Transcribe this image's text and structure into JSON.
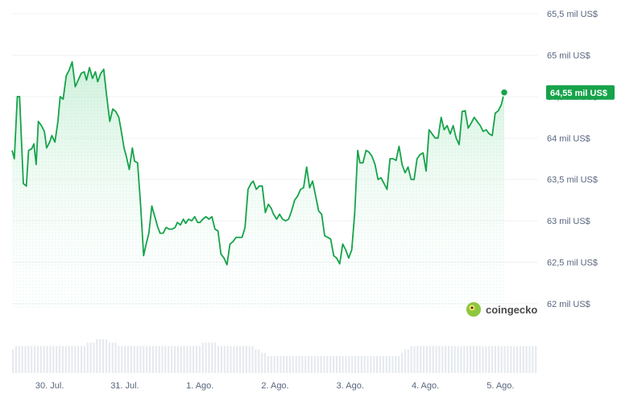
{
  "chart_data": {
    "type": "area",
    "currency_unit": "mil US$",
    "y_ticks": [
      62,
      62.5,
      63,
      63.5,
      64,
      64.5,
      65,
      65.5
    ],
    "y_tick_labels": [
      "62 mil US$",
      "62,5 mil US$",
      "63 mil US$",
      "63,5 mil US$",
      "64 mil US$",
      "64,5 mil US$",
      "65 mil US$",
      "65,5 mil US$"
    ],
    "ylim": [
      61.95,
      65.55
    ],
    "x_tick_labels": [
      "30. Jul.",
      "31. Jul.",
      "1. Ago.",
      "2. Ago.",
      "3. Ago.",
      "4. Ago.",
      "5. Ago."
    ],
    "x_tick_positions": [
      0.5,
      1.5,
      2.5,
      3.5,
      4.5,
      5.5,
      6.5
    ],
    "xlim": [
      0,
      7.0
    ],
    "series": [
      {
        "values": [
          [
            0.0,
            63.85
          ],
          [
            0.03,
            63.75
          ],
          [
            0.07,
            64.5
          ],
          [
            0.1,
            64.5
          ],
          [
            0.15,
            63.45
          ],
          [
            0.19,
            63.42
          ],
          [
            0.22,
            63.85
          ],
          [
            0.26,
            63.87
          ],
          [
            0.29,
            63.93
          ],
          [
            0.32,
            63.68
          ],
          [
            0.35,
            64.2
          ],
          [
            0.39,
            64.15
          ],
          [
            0.43,
            64.08
          ],
          [
            0.46,
            63.88
          ],
          [
            0.5,
            63.95
          ],
          [
            0.53,
            64.03
          ],
          [
            0.57,
            63.95
          ],
          [
            0.61,
            64.2
          ],
          [
            0.64,
            64.5
          ],
          [
            0.68,
            64.47
          ],
          [
            0.72,
            64.75
          ],
          [
            0.76,
            64.82
          ],
          [
            0.8,
            64.92
          ],
          [
            0.84,
            64.62
          ],
          [
            0.88,
            64.7
          ],
          [
            0.92,
            64.78
          ],
          [
            0.96,
            64.8
          ],
          [
            0.99,
            64.7
          ],
          [
            1.03,
            64.85
          ],
          [
            1.07,
            64.72
          ],
          [
            1.11,
            64.8
          ],
          [
            1.14,
            64.68
          ],
          [
            1.18,
            64.78
          ],
          [
            1.22,
            64.83
          ],
          [
            1.26,
            64.5
          ],
          [
            1.3,
            64.2
          ],
          [
            1.34,
            64.35
          ],
          [
            1.38,
            64.32
          ],
          [
            1.42,
            64.25
          ],
          [
            1.45,
            64.1
          ],
          [
            1.49,
            63.88
          ],
          [
            1.52,
            63.78
          ],
          [
            1.56,
            63.62
          ],
          [
            1.6,
            63.88
          ],
          [
            1.63,
            63.72
          ],
          [
            1.67,
            63.7
          ],
          [
            1.71,
            63.2
          ],
          [
            1.75,
            62.58
          ],
          [
            1.78,
            62.7
          ],
          [
            1.82,
            62.85
          ],
          [
            1.86,
            63.18
          ],
          [
            1.9,
            63.05
          ],
          [
            1.94,
            62.92
          ],
          [
            1.97,
            62.85
          ],
          [
            2.01,
            62.85
          ],
          [
            2.05,
            62.92
          ],
          [
            2.09,
            62.9
          ],
          [
            2.13,
            62.9
          ],
          [
            2.17,
            62.92
          ],
          [
            2.2,
            62.98
          ],
          [
            2.24,
            62.95
          ],
          [
            2.28,
            63.02
          ],
          [
            2.31,
            62.97
          ],
          [
            2.35,
            63.02
          ],
          [
            2.39,
            63.0
          ],
          [
            2.43,
            63.05
          ],
          [
            2.47,
            62.98
          ],
          [
            2.5,
            62.98
          ],
          [
            2.54,
            63.02
          ],
          [
            2.58,
            63.05
          ],
          [
            2.62,
            63.02
          ],
          [
            2.66,
            63.05
          ],
          [
            2.7,
            62.9
          ],
          [
            2.74,
            62.88
          ],
          [
            2.78,
            62.6
          ],
          [
            2.82,
            62.55
          ],
          [
            2.86,
            62.47
          ],
          [
            2.9,
            62.72
          ],
          [
            2.94,
            62.75
          ],
          [
            2.98,
            62.8
          ],
          [
            3.02,
            62.8
          ],
          [
            3.06,
            62.8
          ],
          [
            3.1,
            62.92
          ],
          [
            3.14,
            63.38
          ],
          [
            3.18,
            63.45
          ],
          [
            3.21,
            63.48
          ],
          [
            3.25,
            63.38
          ],
          [
            3.29,
            63.42
          ],
          [
            3.33,
            63.42
          ],
          [
            3.37,
            63.1
          ],
          [
            3.41,
            63.2
          ],
          [
            3.45,
            63.15
          ],
          [
            3.48,
            63.08
          ],
          [
            3.52,
            63.02
          ],
          [
            3.56,
            63.08
          ],
          [
            3.6,
            63.02
          ],
          [
            3.64,
            63.0
          ],
          [
            3.68,
            63.02
          ],
          [
            3.72,
            63.12
          ],
          [
            3.76,
            63.25
          ],
          [
            3.8,
            63.3
          ],
          [
            3.84,
            63.38
          ],
          [
            3.88,
            63.4
          ],
          [
            3.92,
            63.65
          ],
          [
            3.96,
            63.4
          ],
          [
            4.0,
            63.48
          ],
          [
            4.04,
            63.3
          ],
          [
            4.08,
            63.12
          ],
          [
            4.12,
            63.08
          ],
          [
            4.16,
            62.82
          ],
          [
            4.2,
            62.8
          ],
          [
            4.24,
            62.78
          ],
          [
            4.28,
            62.58
          ],
          [
            4.32,
            62.55
          ],
          [
            4.36,
            62.48
          ],
          [
            4.4,
            62.72
          ],
          [
            4.44,
            62.65
          ],
          [
            4.48,
            62.55
          ],
          [
            4.52,
            62.65
          ],
          [
            4.56,
            63.1
          ],
          [
            4.6,
            63.85
          ],
          [
            4.63,
            63.7
          ],
          [
            4.67,
            63.7
          ],
          [
            4.71,
            63.85
          ],
          [
            4.75,
            63.83
          ],
          [
            4.79,
            63.78
          ],
          [
            4.83,
            63.68
          ],
          [
            4.87,
            63.5
          ],
          [
            4.91,
            63.52
          ],
          [
            4.95,
            63.45
          ],
          [
            4.99,
            63.38
          ],
          [
            5.03,
            63.75
          ],
          [
            5.07,
            63.75
          ],
          [
            5.11,
            63.73
          ],
          [
            5.15,
            63.9
          ],
          [
            5.19,
            63.68
          ],
          [
            5.23,
            63.58
          ],
          [
            5.27,
            63.65
          ],
          [
            5.31,
            63.5
          ],
          [
            5.35,
            63.5
          ],
          [
            5.39,
            63.75
          ],
          [
            5.43,
            63.8
          ],
          [
            5.47,
            63.82
          ],
          [
            5.51,
            63.6
          ],
          [
            5.55,
            64.1
          ],
          [
            5.59,
            64.05
          ],
          [
            5.63,
            64.0
          ],
          [
            5.67,
            64.0
          ],
          [
            5.71,
            64.25
          ],
          [
            5.75,
            64.1
          ],
          [
            5.79,
            64.15
          ],
          [
            5.83,
            64.05
          ],
          [
            5.87,
            64.15
          ],
          [
            5.91,
            64.0
          ],
          [
            5.95,
            63.92
          ],
          [
            5.99,
            64.32
          ],
          [
            6.03,
            64.33
          ],
          [
            6.07,
            64.12
          ],
          [
            6.11,
            64.18
          ],
          [
            6.15,
            64.25
          ],
          [
            6.19,
            64.2
          ],
          [
            6.23,
            64.15
          ],
          [
            6.27,
            64.08
          ],
          [
            6.31,
            64.1
          ],
          [
            6.35,
            64.05
          ],
          [
            6.39,
            64.03
          ],
          [
            6.43,
            64.3
          ],
          [
            6.47,
            64.33
          ],
          [
            6.51,
            64.4
          ],
          [
            6.55,
            64.55
          ]
        ]
      }
    ],
    "current_value_label": "64,55 mil US$",
    "volume": [
      7,
      8,
      8,
      8,
      8,
      8,
      8,
      8,
      8,
      8,
      8,
      8,
      8,
      8,
      8,
      8,
      8,
      8,
      8,
      8,
      8,
      8,
      8,
      8,
      9,
      9,
      9,
      10,
      10,
      10,
      10,
      9,
      9,
      9,
      8,
      8,
      8,
      8,
      8,
      8,
      8,
      8,
      8,
      8,
      8,
      8,
      8,
      8,
      8,
      8,
      8,
      8,
      8,
      8,
      8,
      8,
      8,
      8,
      8,
      8,
      8,
      9,
      9,
      9,
      9,
      9,
      8,
      8,
      8,
      8,
      8,
      8,
      8,
      8,
      8,
      8,
      8,
      8,
      7,
      7,
      6,
      6,
      5,
      5,
      5,
      5,
      5,
      5,
      5,
      5,
      5,
      5,
      5,
      5,
      5,
      5,
      5,
      5,
      5,
      5,
      5,
      5,
      5,
      5,
      5,
      5,
      5,
      5,
      5,
      5,
      5,
      5,
      5,
      5,
      5,
      5,
      5,
      5,
      5,
      5,
      5,
      5,
      5,
      5,
      5,
      6,
      7,
      7,
      8,
      8,
      8,
      8,
      8,
      8,
      8,
      8,
      8,
      8,
      8,
      8,
      8,
      8,
      8,
      8,
      8,
      8,
      8,
      8,
      8,
      8,
      8,
      8,
      8,
      8,
      8,
      8,
      8,
      8,
      8,
      8,
      8,
      8,
      8,
      8,
      8,
      8,
      8,
      8,
      8
    ],
    "colors": {
      "line": "#16c784",
      "line_dark": "#16a34a",
      "area_top": "#bfeccf",
      "area_bottom": "#ffffff",
      "badge_bg": "#16a34a",
      "grid": "#eff2f5",
      "tick_text": "#58667e",
      "volume": "#e6e9ee",
      "logo_circle": "#8dc63f",
      "logo_inner": "#ffe469"
    },
    "grid": true
  },
  "branding": {
    "logo_text": "coingecko"
  }
}
